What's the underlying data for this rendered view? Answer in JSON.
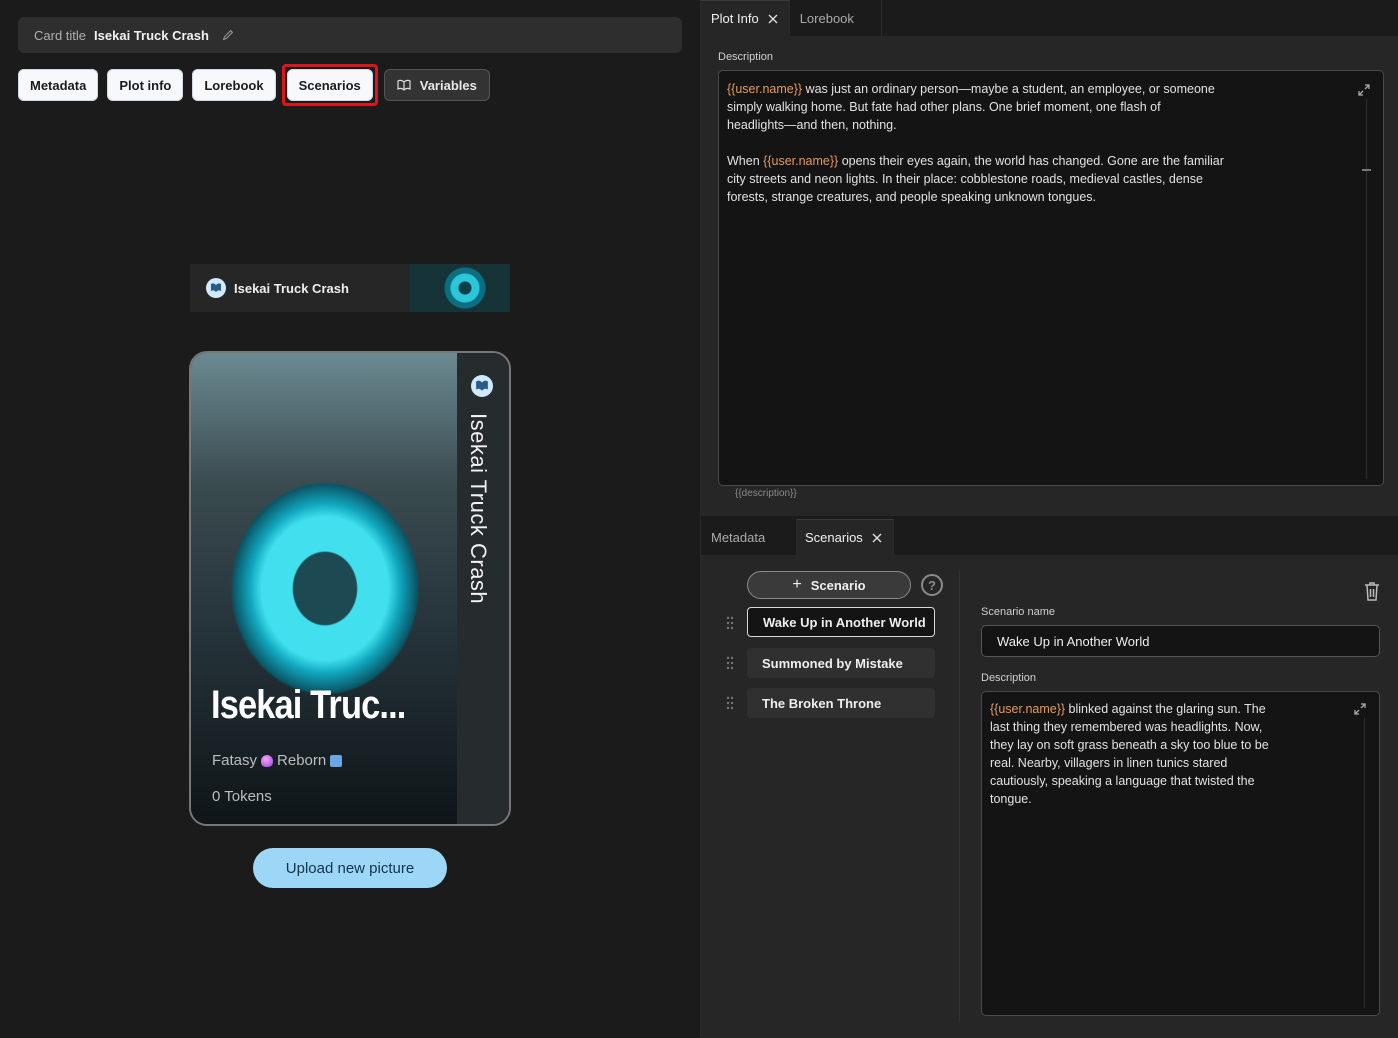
{
  "left": {
    "card_title_label": "Card title",
    "card_title_value": "Isekai Truck Crash",
    "tabs": [
      "Metadata",
      "Plot info",
      "Lorebook",
      "Scenarios",
      "Variables"
    ],
    "selected_tab": "Scenarios",
    "banner_title": "Isekai Truck Crash",
    "card": {
      "vertical_title": "Isekai Truck Crash",
      "big_title": "Isekai Truc...",
      "tag1": "Fatasy",
      "tag2": "Reborn",
      "tokens": "0 Tokens"
    },
    "upload_label": "Upload new picture"
  },
  "plot": {
    "tabs": [
      "Plot Info",
      "Lorebook"
    ],
    "active_tab": "Plot Info",
    "description_label": "Description",
    "desc_token": "{{user.name}}",
    "desc_p1_rest": " was just an ordinary person—maybe a student, an employee, or someone\nsimply walking home. But fate had other plans. One brief moment, one flash of\nheadlights—and then, nothing.",
    "desc_p2_start": "When ",
    "desc_p2_rest": " opens their eyes again, the world has changed. Gone are the familiar\ncity streets and neon lights. In their place: cobblestone roads, medieval castles, dense\nforests, strange creatures, and people speaking unknown tongues.",
    "hint": "{{description}}"
  },
  "scenarios": {
    "tabs": [
      "Metadata",
      "Scenarios"
    ],
    "active_tab": "Scenarios",
    "add_label": "Scenario",
    "help_label": "?",
    "items": [
      "Wake Up in Another World",
      "Summoned by Mistake",
      "The Broken Throne"
    ],
    "selected_item": "Wake Up in Another World",
    "name_label": "Scenario name",
    "name_value": "Wake Up in Another World",
    "description_label": "Description",
    "desc_token": "{{user.name}}",
    "desc_rest": " blinked against the glaring sun. The\nlast thing they remembered was headlights. Now,\nthey lay on soft grass beneath a sky too blue to be\nreal. Nearby, villagers in linen tunics stared\ncautiously, speaking a language that twisted the\ntongue."
  }
}
